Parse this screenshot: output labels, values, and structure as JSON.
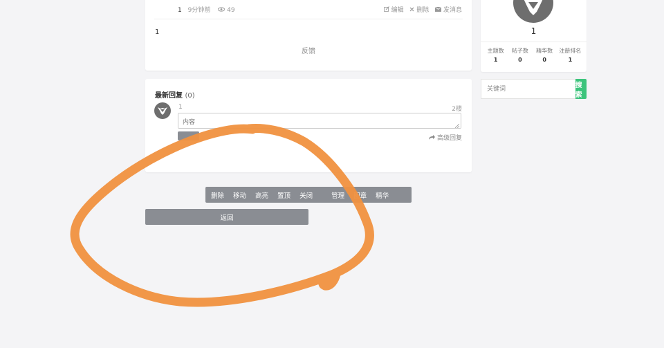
{
  "topic": {
    "author_num": "1",
    "time_ago": "9分钟前",
    "views": "49",
    "actions": {
      "edit": "编辑",
      "delete": "删除",
      "message": "发消息"
    },
    "body": "1",
    "feedback_label": "反馈"
  },
  "replies": {
    "title": "最新回复",
    "count": "(0)",
    "item": {
      "author": "1",
      "floor": "2楼"
    },
    "input_placeholder": "内容",
    "advanced_label": "高级回复"
  },
  "mod_tools": [
    "删除",
    "移动",
    "高亮",
    "置顶",
    "关闭",
    "管理",
    "图章",
    "精华"
  ],
  "back_label": "返回",
  "user": {
    "name": "1",
    "stats": [
      {
        "label": "主题数",
        "value": "1"
      },
      {
        "label": "帖子数",
        "value": "0"
      },
      {
        "label": "精华数",
        "value": "0"
      },
      {
        "label": "注册排名",
        "value": "1"
      }
    ]
  },
  "search": {
    "placeholder": "关键词",
    "button_label": "搜索"
  },
  "colors": {
    "accent_green": "#3cc47c",
    "toolbar_gray": "#8a8d93",
    "annotation_orange": "#f0913f"
  }
}
